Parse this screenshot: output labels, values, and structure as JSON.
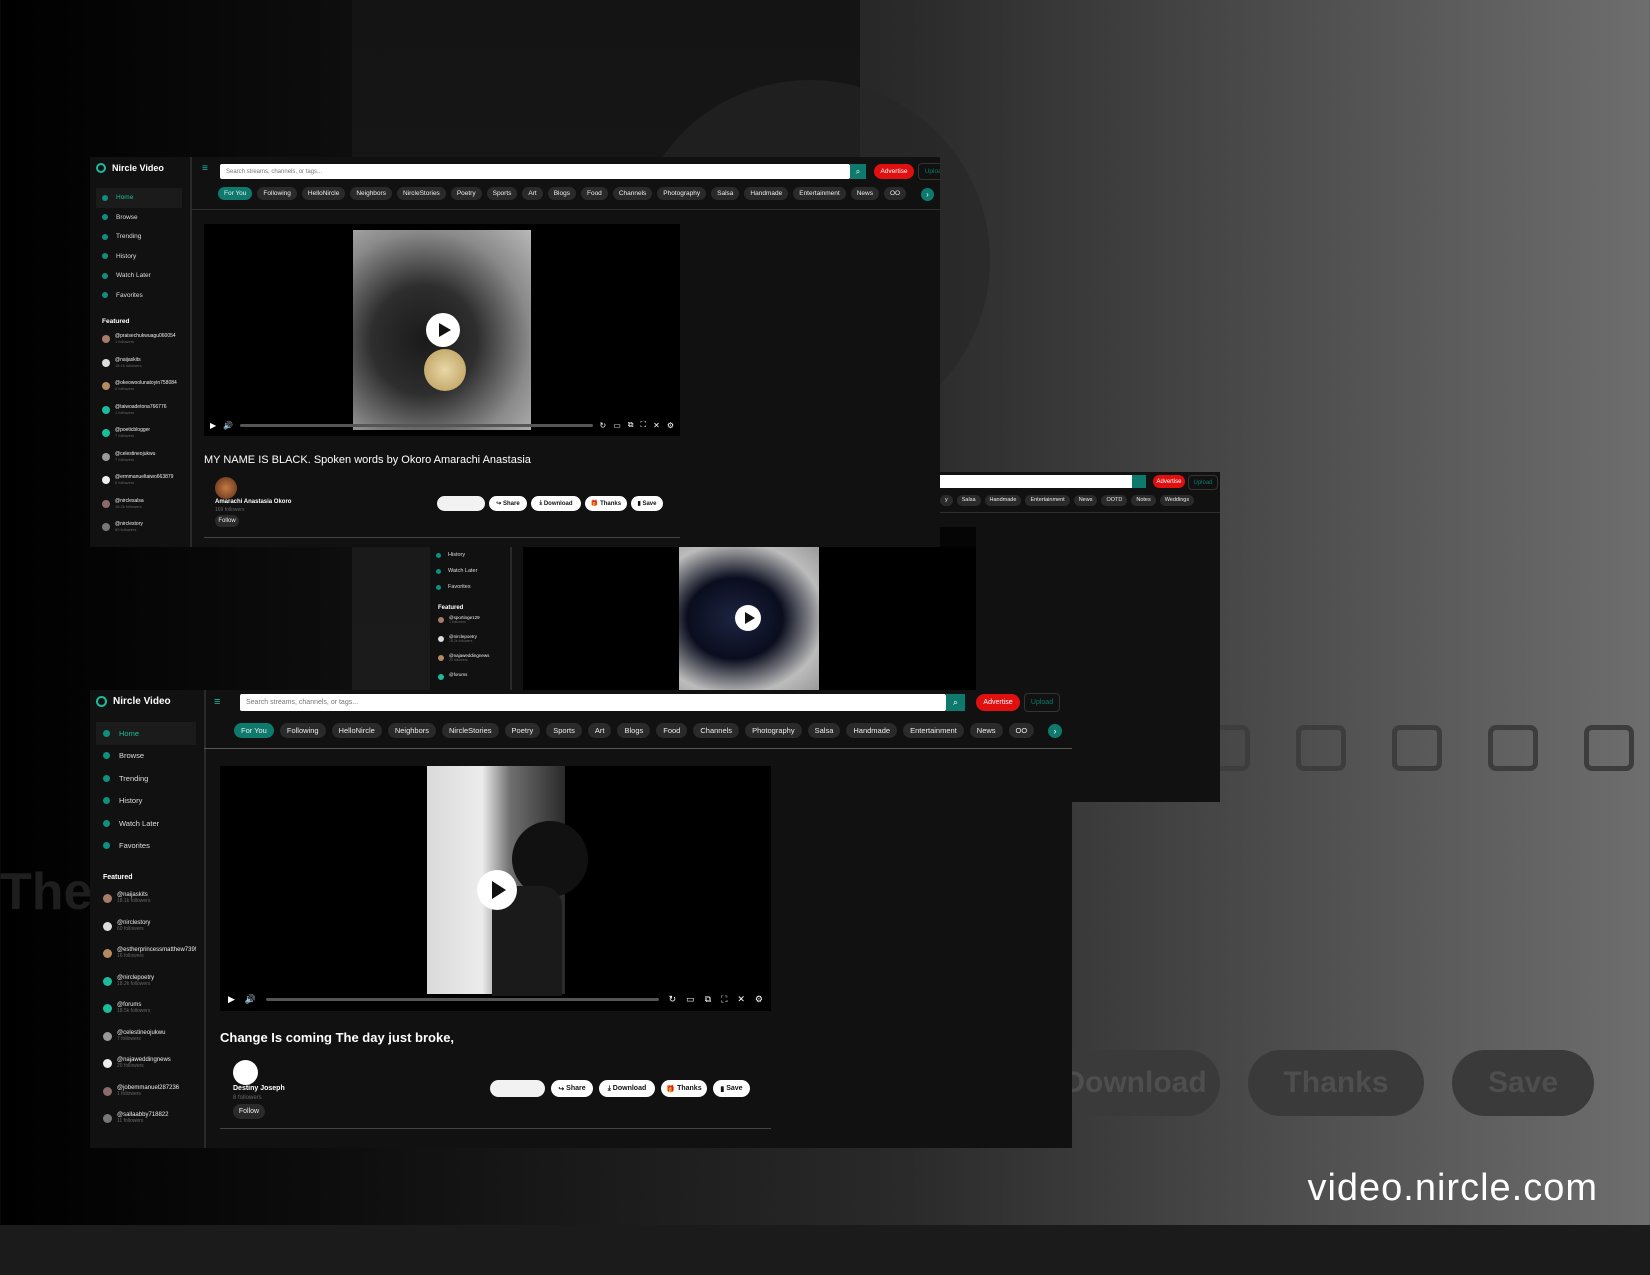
{
  "site_url": "video.nircle.com",
  "ghost": {
    "the": "The",
    "download": "Download",
    "thanks": "Thanks",
    "save": "Save"
  },
  "colors": {
    "accent": "#0e7a6e",
    "advertise": "#e01010",
    "background": "#111111"
  },
  "app": {
    "brand": "Nircle Video",
    "nav": [
      "Home",
      "Browse",
      "Trending",
      "History",
      "Watch Later",
      "Favorites"
    ],
    "featured_heading": "Featured",
    "search_placeholder": "Search streams, channels, or tags...",
    "advertise": "Advertise",
    "upload": "Upload",
    "chips": [
      "For You",
      "Following",
      "HelloNircle",
      "Neighbors",
      "NircleStories",
      "Poetry",
      "Sports",
      "Art",
      "Blogs",
      "Food",
      "Channels",
      "Photography",
      "Salsa",
      "Handmade",
      "Entertainment",
      "News",
      "OO"
    ],
    "actions": {
      "share": "Share",
      "download": "Download",
      "thanks": "Thanks",
      "save": "Save"
    },
    "follow": "Follow"
  },
  "screen1": {
    "featured": [
      {
        "name": "@praisechukwuagu060054",
        "followers": "1 followers"
      },
      {
        "name": "@naijaskits",
        "followers": "18.1k followers"
      },
      {
        "name": "@okeowoolunatoyin758084",
        "followers": "6 followers"
      },
      {
        "name": "@taiwoadetona766776",
        "followers": "1 followers"
      },
      {
        "name": "@poeticblogger",
        "followers": "7 followers"
      },
      {
        "name": "@celestineojukwu",
        "followers": "7 followers"
      },
      {
        "name": "@ermmanueltaiwo663879",
        "followers": "6 followers"
      },
      {
        "name": "@nirclesalsa",
        "followers": "18.2k followers"
      },
      {
        "name": "@nirclestory",
        "followers": "60 followers"
      }
    ],
    "video_title": "MY NAME IS BLACK. Spoken words by Okoro Amarachi Anastasia",
    "channel_name": "Amarachi Anastasia Okoro",
    "channel_followers": "169 followers"
  },
  "screen2": {
    "featured": [
      {
        "name": "@naijaskits",
        "followers": "18.1k followers"
      },
      {
        "name": "@nirclestory",
        "followers": "60 followers"
      },
      {
        "name": "@estherprincessmatthew739!",
        "followers": "16 followers"
      },
      {
        "name": "@nirclepoetry",
        "followers": "18.2k followers"
      },
      {
        "name": "@forums",
        "followers": "18.5k followers"
      },
      {
        "name": "@celestineojukwu",
        "followers": "7 followers"
      },
      {
        "name": "@najaweddingnews",
        "followers": "20 followers"
      },
      {
        "name": "@jobemmanuel287236",
        "followers": "1 followers"
      },
      {
        "name": "@sallaabby718822",
        "followers": "11 followers"
      }
    ],
    "video_title": "Change Is coming The day just broke,",
    "channel_name": "Destiny Joseph",
    "channel_followers": "8 followers"
  },
  "mid": {
    "nav": [
      "History",
      "Watch Later",
      "Favorites"
    ],
    "featured": [
      {
        "name": "@sportinge129",
        "followers": "1 followers"
      },
      {
        "name": "@nirclepoetry",
        "followers": "18.2k followers"
      },
      {
        "name": "@najaweddingnews",
        "followers": "20 followers"
      },
      {
        "name": "@forums",
        "followers": ""
      }
    ]
  },
  "right": {
    "chips": [
      "y",
      "Salsa",
      "Handmade",
      "Entertainment",
      "News",
      "OOTD",
      "Notes",
      "Weddings"
    ]
  }
}
